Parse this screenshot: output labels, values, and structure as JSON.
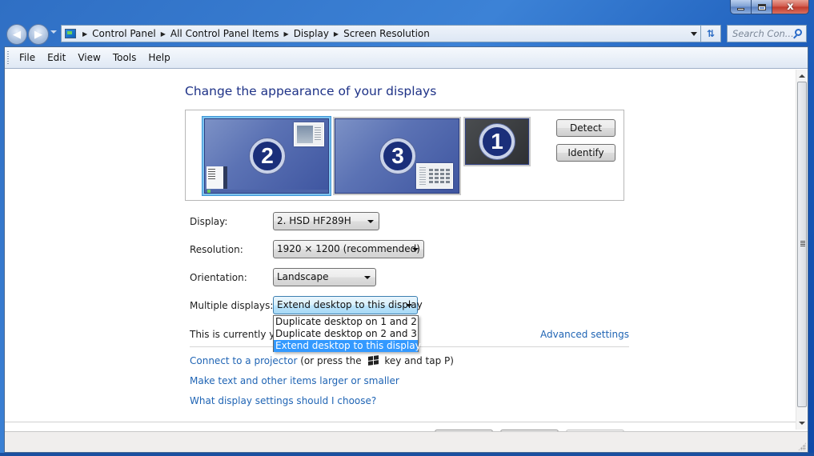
{
  "window": {
    "controls": {
      "minimize": "minimize",
      "maximize": "maximize",
      "close": "x"
    }
  },
  "nav": {
    "back_icon": "back-arrow-icon",
    "forward_icon": "forward-arrow-icon",
    "breadcrumbs": [
      "Control Panel",
      "All Control Panel Items",
      "Display",
      "Screen Resolution"
    ],
    "search_placeholder": "Search Con..."
  },
  "menu": [
    "File",
    "Edit",
    "View",
    "Tools",
    "Help"
  ],
  "main": {
    "title": "Change the appearance of your displays",
    "monitors": [
      {
        "number": "2",
        "selected": true
      },
      {
        "number": "3",
        "selected": false
      },
      {
        "number": "1",
        "selected": false
      }
    ],
    "detect_label": "Detect",
    "identify_label": "Identify",
    "fields": {
      "display_label": "Display:",
      "display_value": "2. HSD HF289H",
      "resolution_label": "Resolution:",
      "resolution_value": "1920 × 1200 (recommended)",
      "orientation_label": "Orientation:",
      "orientation_value": "Landscape",
      "multiple_label": "Multiple displays:",
      "multiple_value": "Extend desktop to this display"
    },
    "multiple_options": [
      "Duplicate desktop on 1 and 2",
      "Duplicate desktop on 2 and 3",
      "Extend desktop to this display"
    ],
    "multiple_selected_index": 2,
    "info_text": "This is currently you",
    "advanced_settings": "Advanced settings",
    "projector_link": "Connect to a projector",
    "projector_hint_pre": "(or press the",
    "projector_hint_post": "key and tap P)",
    "text_size_link": "Make text and other items larger or smaller",
    "help_link": "What display settings should I choose?"
  }
}
